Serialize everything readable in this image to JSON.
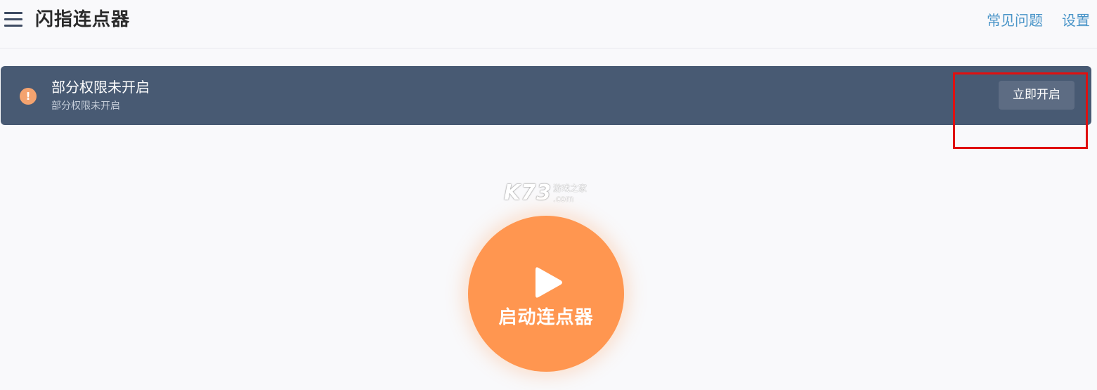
{
  "header": {
    "menu_icon": "hamburger-menu-icon",
    "title": "闪指连点器",
    "links": {
      "faq": "常见问题",
      "settings": "设置"
    },
    "link_color": "#4a95c8"
  },
  "permission_banner": {
    "icon": "exclamation-circle-icon",
    "icon_color": "#f4a36f",
    "background_color": "#485a73",
    "title": "部分权限未开启",
    "subtitle": "部分权限未开启",
    "action_label": "立即开启"
  },
  "watermark": {
    "logo": "K73",
    "text": "游戏之家",
    "domain": ".com"
  },
  "start_button": {
    "icon": "play-icon",
    "label": "启动连点器",
    "color": "#ff9650"
  },
  "annotation": {
    "highlight_color": "#e01010"
  }
}
